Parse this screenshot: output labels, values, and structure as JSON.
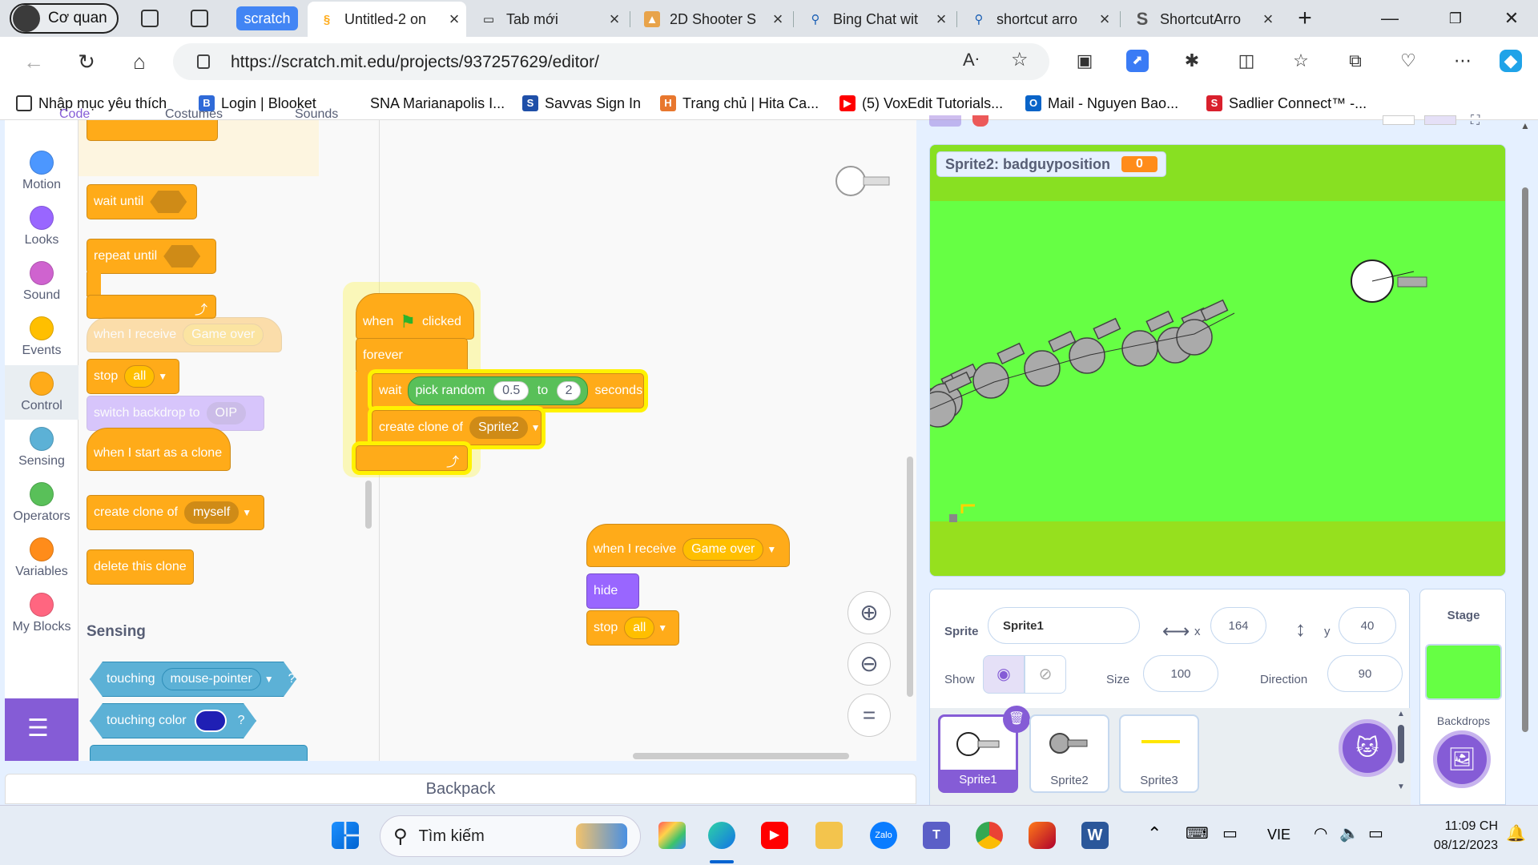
{
  "browser": {
    "profile": "Cơ quan",
    "tab_group": "scratch",
    "tabs": [
      {
        "title": "Untitled-2 on",
        "active": true
      },
      {
        "title": "Tab mới"
      },
      {
        "title": "2D Shooter S"
      },
      {
        "title": "Bing Chat wit"
      },
      {
        "title": "shortcut arro"
      },
      {
        "title": "ShortcutArro"
      }
    ],
    "url": "https://scratch.mit.edu/projects/937257629/editor/",
    "bookmarks": [
      "Nhập mục yêu thích",
      "Login | Blooket",
      "SNA Marianapolis I...",
      "Savvas Sign In",
      "Trang chủ | Hita Ca...",
      "(5) VoxEdit Tutorials...",
      "Mail - Nguyen Bao...",
      "Sadlier Connect™ -..."
    ]
  },
  "editor": {
    "top_tabs": [
      "Code",
      "Costumes",
      "Sounds"
    ],
    "categories": [
      {
        "label": "Motion",
        "color": "#4c97ff"
      },
      {
        "label": "Looks",
        "color": "#9966ff"
      },
      {
        "label": "Sound",
        "color": "#cf63cf"
      },
      {
        "label": "Events",
        "color": "#ffbf00"
      },
      {
        "label": "Control",
        "color": "#ffab19"
      },
      {
        "label": "Sensing",
        "color": "#5cb1d6"
      },
      {
        "label": "Operators",
        "color": "#59c059"
      },
      {
        "label": "Variables",
        "color": "#ff8c1a"
      },
      {
        "label": "My Blocks",
        "color": "#ff6680"
      }
    ],
    "palette": {
      "wait_until": "wait until",
      "repeat_until": "repeat until",
      "when_receive_faded": "when I receive",
      "when_receive_faded_val": "Game over",
      "stop": "stop",
      "stop_val": "all",
      "switch_backdrop": "switch backdrop to",
      "switch_backdrop_val": "OIP",
      "start_as_clone": "when I start as a clone",
      "create_clone": "create clone of",
      "create_clone_val": "myself",
      "delete_clone": "delete this clone",
      "sensing_header": "Sensing",
      "touching": "touching",
      "touching_val": "mouse-pointer",
      "touching_q": "?",
      "touching_color": "touching color",
      "touching_color_q": "?"
    },
    "script1": {
      "when": "when",
      "clicked": "clicked",
      "forever": "forever",
      "wait": "wait",
      "pick_random": "pick random",
      "from": "0.5",
      "to_label": "to",
      "to": "2",
      "seconds": "seconds",
      "create_clone": "create clone of",
      "clone_target": "Sprite2"
    },
    "script2": {
      "when_receive": "when I receive",
      "message": "Game over",
      "hide": "hide",
      "stop": "stop",
      "stop_val": "all"
    },
    "backpack": "Backpack"
  },
  "stage": {
    "monitor_label": "Sprite2: badguyposition",
    "monitor_value": "0",
    "background_color": "#66ff44"
  },
  "sprite_info": {
    "sprite_label": "Sprite",
    "name": "Sprite1",
    "x_label": "x",
    "x": "164",
    "y_label": "y",
    "y": "40",
    "show_label": "Show",
    "size_label": "Size",
    "size": "100",
    "direction_label": "Direction",
    "direction": "90",
    "sprites": [
      "Sprite1",
      "Sprite2",
      "Sprite3"
    ]
  },
  "stage_panel": {
    "title": "Stage",
    "backdrops_label": "Backdrops"
  },
  "taskbar": {
    "search_placeholder": "Tìm kiếm",
    "language": "VIE",
    "time": "11:09 CH",
    "date": "08/12/2023"
  }
}
